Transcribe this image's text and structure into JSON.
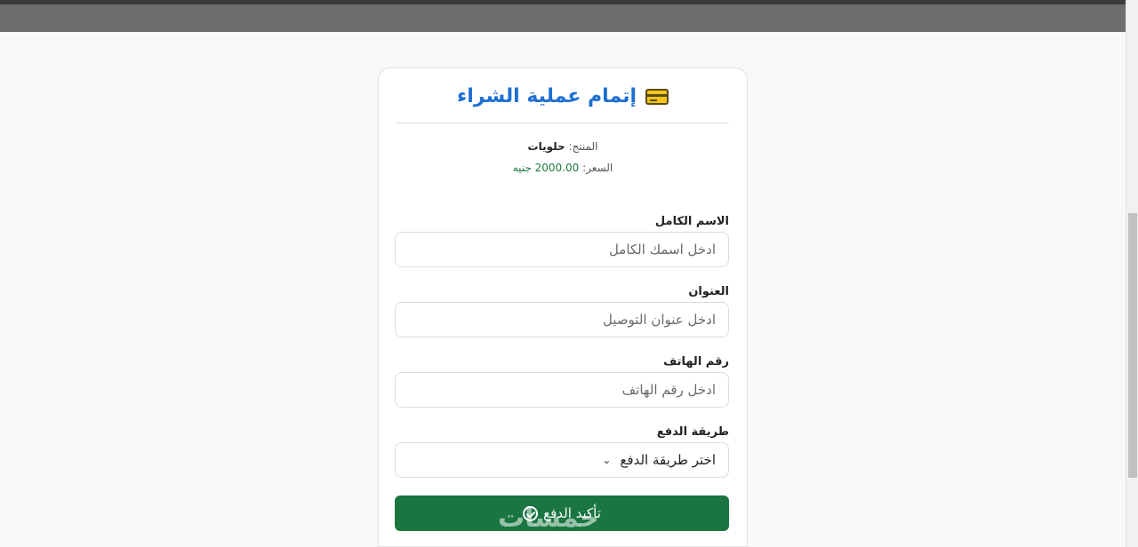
{
  "checkout": {
    "title": "إتمام عملية الشراء",
    "icon": "credit-card-icon",
    "product_label": "المنتج:",
    "product_value": "حلويات",
    "price_label": "السعر:",
    "price_value": "2000.00 جنيه",
    "fields": [
      {
        "label": "الاسم الكامل",
        "placeholder": "ادخل اسمك الكامل"
      },
      {
        "label": "العنوان",
        "placeholder": "ادخل عنوان التوصيل"
      },
      {
        "label": "رقم الهاتف",
        "placeholder": "ادخل رقم الهاتف"
      }
    ],
    "payment": {
      "label": "طريقة الدفع",
      "selected": "اختر طريقة الدفع"
    },
    "submit_label": "تأكيد الدفع",
    "watermark": "خمسات"
  },
  "colors": {
    "title": "#1f6fd0",
    "price": "#1a7a3a",
    "button": "#1a7541"
  }
}
